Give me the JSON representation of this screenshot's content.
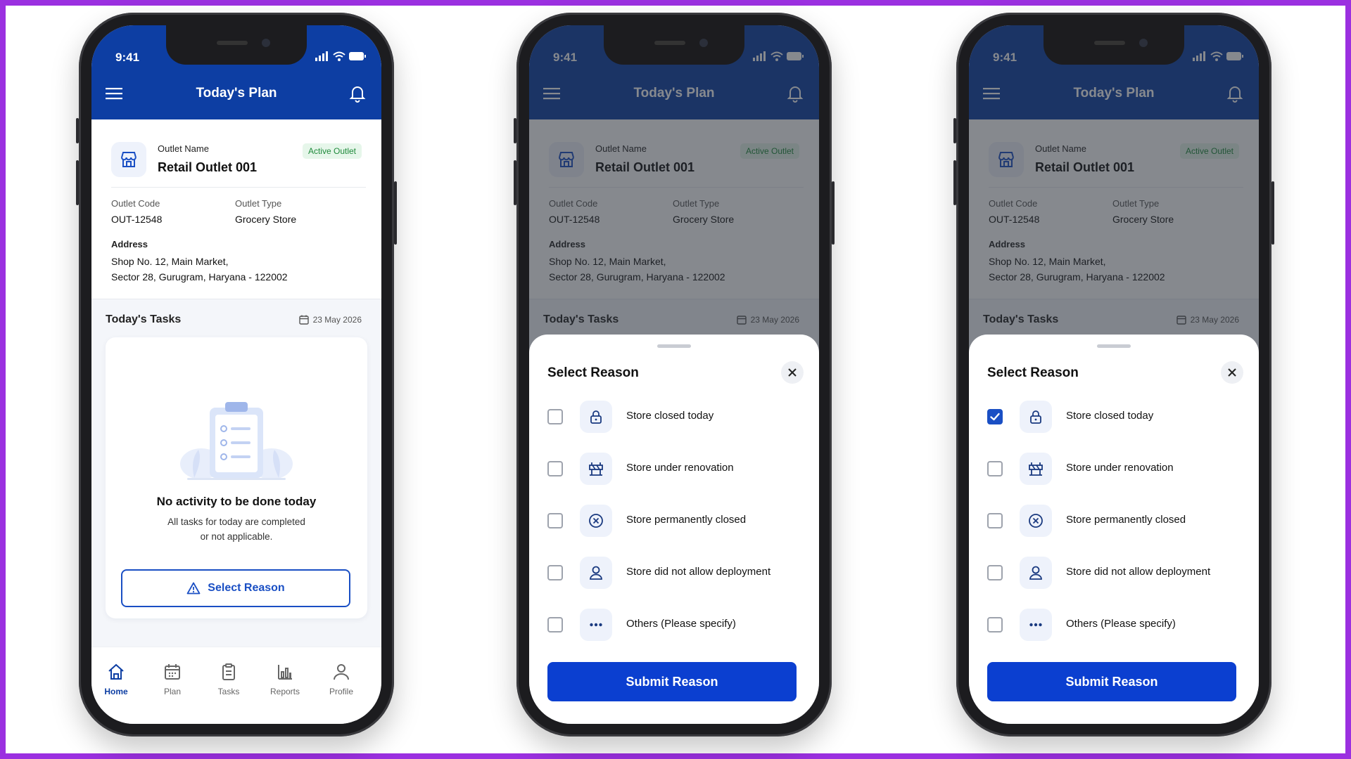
{
  "status_time": "9:41",
  "app_title": "Today's Plan",
  "outlet": {
    "name_label": "Outlet Name",
    "name": "Retail Outlet 001",
    "badge": "Active Outlet",
    "code_label": "Outlet Code",
    "code": "OUT-12548",
    "type_label": "Outlet Type",
    "type": "Grocery Store",
    "address_label": "Address",
    "address_line1": "Shop No. 12, Main Market,",
    "address_line2": "Sector 28, Gurugram, Haryana - 122002"
  },
  "tasks": {
    "header": "Today's Tasks",
    "date": "23 May 2026",
    "empty_title": "No activity to be done today",
    "empty_sub_line1": "All tasks for today are completed",
    "empty_sub_line2": "or not applicable.",
    "select_reason_label": "Select Reason"
  },
  "nav": [
    {
      "label": "Home",
      "icon": "home-icon"
    },
    {
      "label": "Plan",
      "icon": "calendar-icon"
    },
    {
      "label": "Tasks",
      "icon": "clipboard-icon"
    },
    {
      "label": "Reports",
      "icon": "bar-chart-icon"
    },
    {
      "label": "Profile",
      "icon": "user-icon"
    }
  ],
  "sheet": {
    "title": "Select Reason",
    "options": [
      {
        "label": "Store closed today",
        "icon": "lock-icon"
      },
      {
        "label": "Store under renovation",
        "icon": "barrier-icon"
      },
      {
        "label": "Store permanently closed",
        "icon": "x-circle-icon"
      },
      {
        "label": "Store did not allow deployment",
        "icon": "user-icon"
      },
      {
        "label": "Others (Please specify)",
        "icon": "more-dots-icon"
      }
    ],
    "submit_label": "Submit Reason"
  },
  "states": [
    {
      "screen": "plan",
      "selected_option": null
    },
    {
      "screen": "reason-sheet",
      "selected_option": null
    },
    {
      "screen": "reason-sheet",
      "selected_option": 0
    }
  ],
  "colors": {
    "primary": "#0d3ea3",
    "button": "#0b3fd0",
    "badge_bg": "#e6f6ea",
    "badge_text": "#1f8a3b",
    "frame": "#9b30e0"
  }
}
